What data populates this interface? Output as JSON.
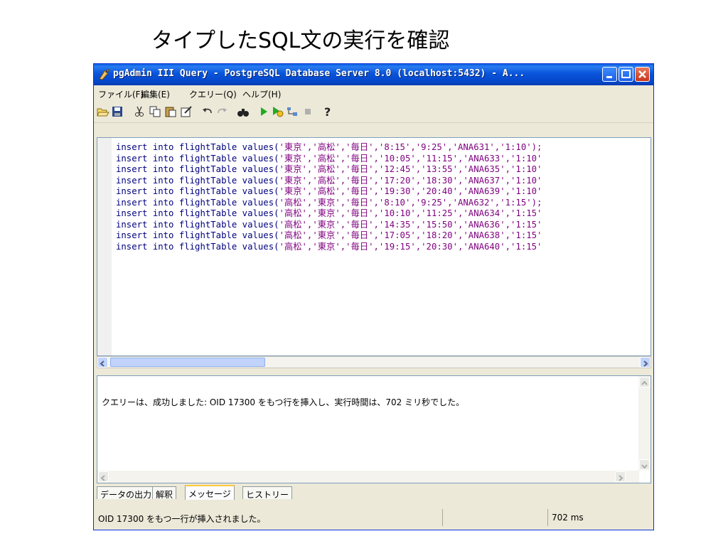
{
  "slide": {
    "title": "タイプしたSQL文の実行を確認"
  },
  "window": {
    "title": "pgAdmin III Query - PostgreSQL Database Server 8.0 (localhost:5432) - A...",
    "colors": {
      "titlebar": "#0854dc",
      "keyword": "#00007f",
      "string": "#7f007f"
    }
  },
  "menu": {
    "items": [
      "ファイル(F)",
      "編集(E)",
      "クエリー(Q)",
      "ヘルプ(H)"
    ]
  },
  "toolbar": {
    "icons": [
      "open-icon",
      "save-icon",
      "cut-icon",
      "copy-icon",
      "paste-icon",
      "clear-icon",
      "undo-icon",
      "redo-icon",
      "find-icon",
      "execute-icon",
      "execute-to-file-icon",
      "explain-icon",
      "cancel-icon",
      "help-icon"
    ]
  },
  "editor": {
    "lines": [
      {
        "kw": "insert into flightTable values(",
        "vals": "'東京','高松','毎日','8:15','9:25','ANA631','1:10');"
      },
      {
        "kw": "insert into flightTable values(",
        "vals": "'東京','高松','毎日','10:05','11:15','ANA633','1:10'"
      },
      {
        "kw": "insert into flightTable values(",
        "vals": "'東京','高松','毎日','12:45','13:55','ANA635','1:10'"
      },
      {
        "kw": "insert into flightTable values(",
        "vals": "'東京','高松','毎日','17:20','18:30','ANA637','1:10'"
      },
      {
        "kw": "insert into flightTable values(",
        "vals": "'東京','高松','毎日','19:30','20:40','ANA639','1:10'"
      },
      {
        "kw": "insert into flightTable values(",
        "vals": "'高松','東京','毎日','8:10','9:25','ANA632','1:15');"
      },
      {
        "kw": "insert into flightTable values(",
        "vals": "'高松','東京','毎日','10:10','11:25','ANA634','1:15'"
      },
      {
        "kw": "insert into flightTable values(",
        "vals": "'高松','東京','毎日','14:35','15:50','ANA636','1:15'"
      },
      {
        "kw": "insert into flightTable values(",
        "vals": "'高松','東京','毎日','17:05','18:20','ANA638','1:15'"
      },
      {
        "kw": "insert into flightTable values(",
        "vals": "'高松','東京','毎日','19:15','20:30','ANA640','1:15'"
      }
    ]
  },
  "messages": {
    "text": "クエリーは、成功しました: OID 17300 をもつ行を挿入し、実行時間は、702 ミリ秒でした。"
  },
  "tabs": {
    "items": [
      "データの出力",
      "解釈",
      "メッセージ",
      "ヒストリー"
    ],
    "active": "メッセージ"
  },
  "status": {
    "left": "OID 17300 をもつ一行が挿入されました。",
    "right": "702 ms"
  }
}
